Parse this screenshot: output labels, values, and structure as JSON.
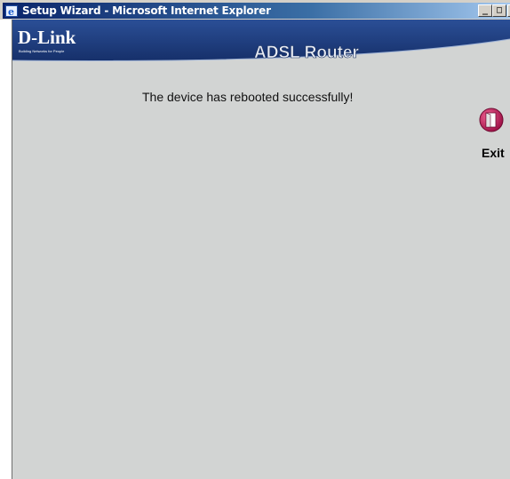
{
  "window": {
    "title": "Setup Wizard - Microsoft Internet Explorer",
    "minimize_glyph": "_",
    "maximize_glyph": "□",
    "close_glyph": "×"
  },
  "header": {
    "logo_text": "D-Link",
    "logo_tagline": "Building Networks for People",
    "product_title": "ADSL Router"
  },
  "main": {
    "message": "The device has rebooted successfully!"
  },
  "exit": {
    "label": "Exit",
    "icon": "exit-door-icon"
  },
  "colors": {
    "banner_blue": "#1f3f84",
    "content_gray": "#d2d4d3",
    "exit_icon": "#c2185b"
  }
}
